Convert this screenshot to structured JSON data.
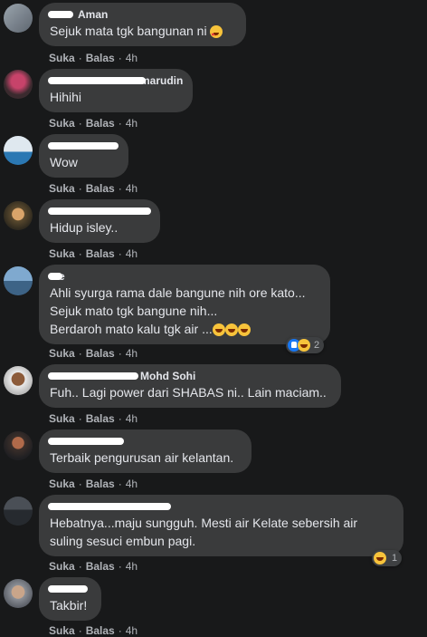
{
  "comments": [
    {
      "name": "Aman",
      "text_lines": [
        "Sejuk mata tgk bangunan ni"
      ],
      "like_label": "Suka",
      "reply_label": "Balas",
      "time": "4h"
    },
    {
      "name": "marudin",
      "text_lines": [
        "Hihihi"
      ],
      "like_label": "Suka",
      "reply_label": "Balas",
      "time": "4h"
    },
    {
      "name": "",
      "text_lines": [
        "Wow"
      ],
      "like_label": "Suka",
      "reply_label": "Balas",
      "time": "4h"
    },
    {
      "name": "",
      "text_lines": [
        "Hidup isley.."
      ],
      "like_label": "Suka",
      "reply_label": "Balas",
      "time": "4h"
    },
    {
      "name": "e",
      "text_lines": [
        "Ahli syurga rama dale bangune nih ore kato...",
        "Sejuk mato tgk bangune nih...",
        "Berdaroh mato kalu tgk air ..."
      ],
      "like_label": "Suka",
      "reply_label": "Balas",
      "time": "4h",
      "reaction_count": "2"
    },
    {
      "name": "Mohd Sohi",
      "text_lines": [
        "Fuh.. Lagi power dari SHABAS ni.. Lain maciam.."
      ],
      "like_label": "Suka",
      "reply_label": "Balas",
      "time": "4h"
    },
    {
      "name": "",
      "text_lines": [
        "Terbaik pengurusan air kelantan."
      ],
      "like_label": "Suka",
      "reply_label": "Balas",
      "time": "4h"
    },
    {
      "name": "",
      "text_lines": [
        "Hebatnya...maju sungguh. Mesti air Kelate sebersih air",
        "suling sesuci embun pagi."
      ],
      "like_label": "Suka",
      "reply_label": "Balas",
      "time": "4h",
      "reaction_count": "1"
    },
    {
      "name": "",
      "text_lines": [
        "Takbir!"
      ],
      "like_label": "Suka",
      "reply_label": "Balas",
      "time": "4h"
    }
  ],
  "colors": {
    "background": "#18191a",
    "bubble": "#3a3b3c",
    "text": "#e4e6eb",
    "muted": "#b0b3b8"
  },
  "icons": [
    "heart-eyes-emoji-icon",
    "rofl-emoji-icon",
    "like-reaction-icon",
    "laugh-reaction-icon"
  ]
}
